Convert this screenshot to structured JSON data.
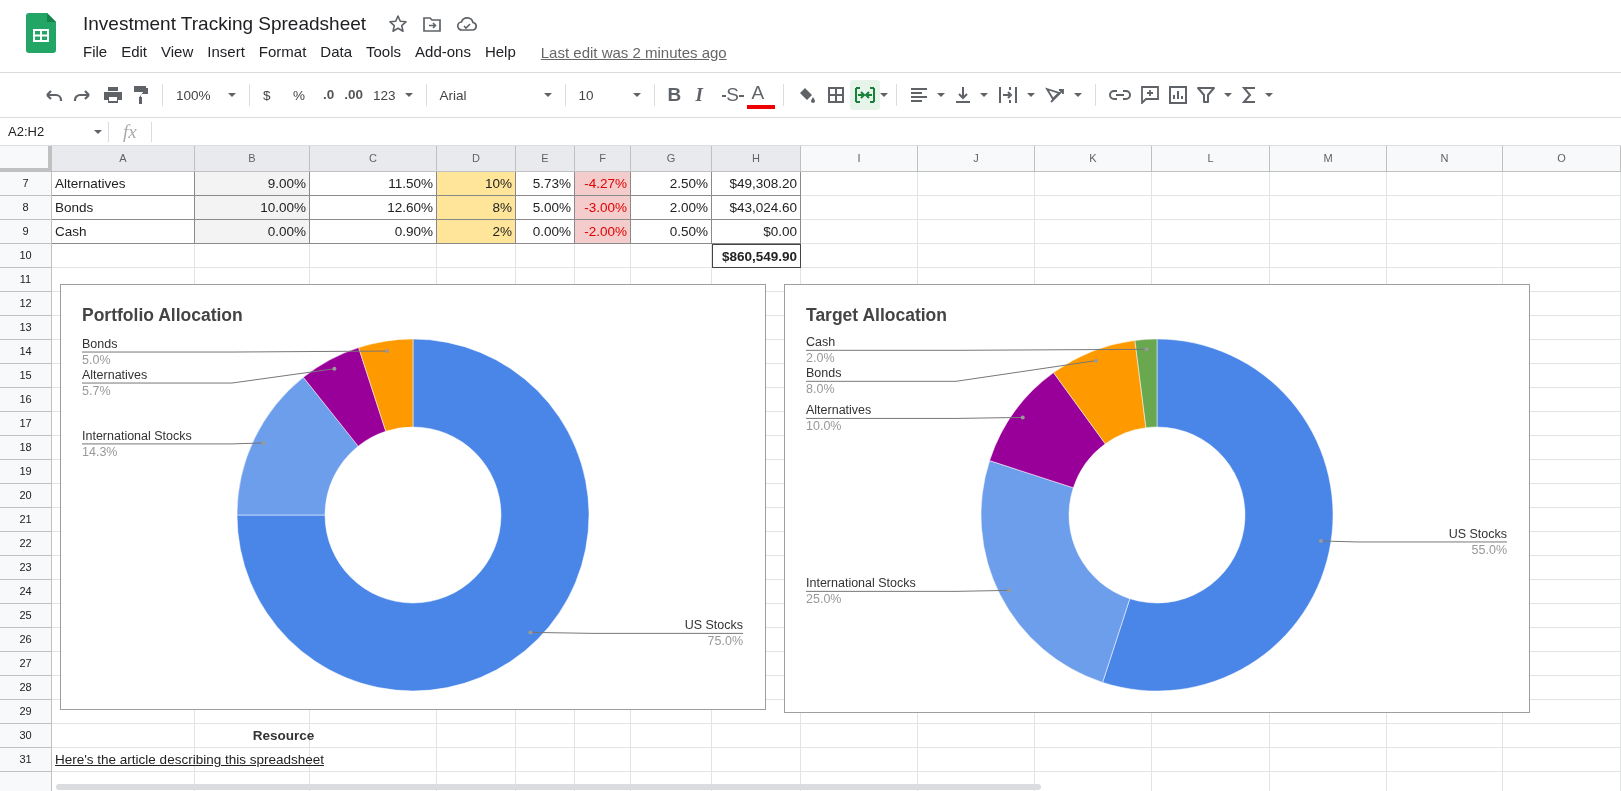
{
  "document": {
    "title": "Investment Tracking Spreadsheet",
    "last_edit": "Last edit was 2 minutes ago"
  },
  "menu": [
    "File",
    "Edit",
    "View",
    "Insert",
    "Format",
    "Data",
    "Tools",
    "Add-ons",
    "Help"
  ],
  "toolbar": {
    "zoom": "100%",
    "currency": "$",
    "percent": "%",
    "decrease_decimals": ".0",
    "increase_decimals": ".00",
    "more_formats": "123",
    "font": "Arial",
    "font_size": "10",
    "bold": "B",
    "italic": "I",
    "strikethrough": "S",
    "text_color": "A",
    "merge_cells_on": true
  },
  "formula_bar": {
    "name_box": "A2:H2",
    "function_label": "fx"
  },
  "columns": [
    {
      "label": "A",
      "kind": "label",
      "selected": true
    },
    {
      "label": "B",
      "kind": "input",
      "selected": true
    },
    {
      "label": "C",
      "kind": "plain",
      "selected": true
    },
    {
      "label": "D",
      "kind": "target",
      "selected": true
    },
    {
      "label": "E",
      "kind": "plain",
      "selected": true
    },
    {
      "label": "F",
      "kind": "alert",
      "selected": true
    },
    {
      "label": "G",
      "kind": "plain",
      "selected": true
    },
    {
      "label": "H",
      "kind": "plain",
      "selected": true
    },
    {
      "label": "I",
      "kind": "plain",
      "selected": false
    },
    {
      "label": "J",
      "kind": "plain",
      "selected": false
    },
    {
      "label": "K",
      "kind": "plain",
      "selected": false
    },
    {
      "label": "L",
      "kind": "plain",
      "selected": false
    },
    {
      "label": "M",
      "kind": "plain",
      "selected": false
    },
    {
      "label": "N",
      "kind": "plain",
      "selected": false
    },
    {
      "label": "O",
      "kind": "plain",
      "selected": false
    }
  ],
  "rows": [
    {
      "number": "7",
      "kind": "data",
      "cells": [
        "Alternatives",
        "9.00%",
        "11.50%",
        "10%",
        "5.73%",
        "-4.27%",
        "2.50%",
        "$49,308.20"
      ]
    },
    {
      "number": "8",
      "kind": "data",
      "cells": [
        "Bonds",
        "10.00%",
        "12.60%",
        "8%",
        "5.00%",
        "-3.00%",
        "2.00%",
        "$43,024.60"
      ]
    },
    {
      "number": "9",
      "kind": "data",
      "cells": [
        "Cash",
        "0.00%",
        "0.90%",
        "2%",
        "0.00%",
        "-2.00%",
        "0.50%",
        "$0.00"
      ]
    },
    {
      "number": "10",
      "kind": "total",
      "text": "$860,549.90"
    },
    {
      "number": "11",
      "kind": "blank"
    },
    {
      "number": "12",
      "kind": "blank"
    },
    {
      "number": "13",
      "kind": "blank"
    },
    {
      "number": "14",
      "kind": "blank"
    },
    {
      "number": "15",
      "kind": "blank"
    },
    {
      "number": "16",
      "kind": "blank"
    },
    {
      "number": "17",
      "kind": "blank"
    },
    {
      "number": "18",
      "kind": "blank"
    },
    {
      "number": "19",
      "kind": "blank"
    },
    {
      "number": "20",
      "kind": "blank"
    },
    {
      "number": "21",
      "kind": "blank"
    },
    {
      "number": "22",
      "kind": "blank"
    },
    {
      "number": "23",
      "kind": "blank"
    },
    {
      "number": "24",
      "kind": "blank"
    },
    {
      "number": "25",
      "kind": "blank"
    },
    {
      "number": "26",
      "kind": "blank"
    },
    {
      "number": "27",
      "kind": "blank"
    },
    {
      "number": "28",
      "kind": "blank"
    },
    {
      "number": "29",
      "kind": "blank"
    },
    {
      "number": "30",
      "kind": "heading",
      "text": "Resource"
    },
    {
      "number": "31",
      "kind": "link",
      "text": "Here's the article describing this spreadsheet"
    }
  ],
  "charts": [
    {
      "chart_data": {
        "type": "donut",
        "title": "Portfolio Allocation",
        "categories": [
          "US Stocks",
          "International Stocks",
          "Alternatives",
          "Bonds"
        ],
        "values": [
          75.0,
          14.3,
          5.7,
          5.0
        ],
        "value_labels": [
          "75.0%",
          "14.3%",
          "5.7%",
          "5.0%"
        ]
      }
    },
    {
      "chart_data": {
        "type": "donut",
        "title": "Target Allocation",
        "categories": [
          "US Stocks",
          "International Stocks",
          "Alternatives",
          "Bonds",
          "Cash"
        ],
        "values": [
          55.0,
          25.0,
          10.0,
          8.0,
          2.0
        ],
        "value_labels": [
          "55.0%",
          "25.0%",
          "10.0%",
          "8.0%",
          "2.0%"
        ]
      }
    }
  ]
}
